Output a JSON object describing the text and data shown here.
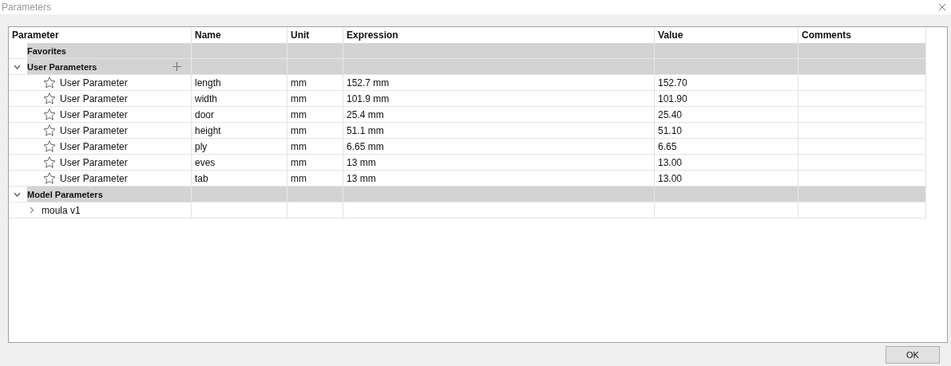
{
  "window": {
    "title": "Parameters"
  },
  "table": {
    "columns": [
      "Parameter",
      "Name",
      "Unit",
      "Expression",
      "Value",
      "Comments"
    ],
    "groups": [
      {
        "kind": "favorites",
        "label": "Favorites"
      },
      {
        "kind": "user",
        "label": "User Parameters",
        "expanded": true,
        "rows": [
          {
            "parameter": "User Parameter",
            "name": "length",
            "unit": "mm",
            "expression": "152.7 mm",
            "value": "152.70",
            "favorite": false
          },
          {
            "parameter": "User Parameter",
            "name": "width",
            "unit": "mm",
            "expression": "101.9 mm",
            "value": "101.90",
            "favorite": false
          },
          {
            "parameter": "User Parameter",
            "name": "door",
            "unit": "mm",
            "expression": "25.4 mm",
            "value": "25.40",
            "favorite": false
          },
          {
            "parameter": "User Parameter",
            "name": "height",
            "unit": "mm",
            "expression": "51.1 mm",
            "value": "51.10",
            "favorite": false
          },
          {
            "parameter": "User Parameter",
            "name": "ply",
            "unit": "mm",
            "expression": "6.65 mm",
            "value": "6.65",
            "favorite": false
          },
          {
            "parameter": "User Parameter",
            "name": "eves",
            "unit": "mm",
            "expression": "13 mm",
            "value": "13.00",
            "favorite": false
          },
          {
            "parameter": "User Parameter",
            "name": "tab",
            "unit": "mm",
            "expression": "13 mm",
            "value": "13.00",
            "favorite": false
          }
        ]
      },
      {
        "kind": "model",
        "label": "Model Parameters",
        "expanded": true,
        "children": [
          {
            "label": "moula v1",
            "expanded": false
          }
        ]
      }
    ]
  },
  "buttons": [
    "OK"
  ]
}
